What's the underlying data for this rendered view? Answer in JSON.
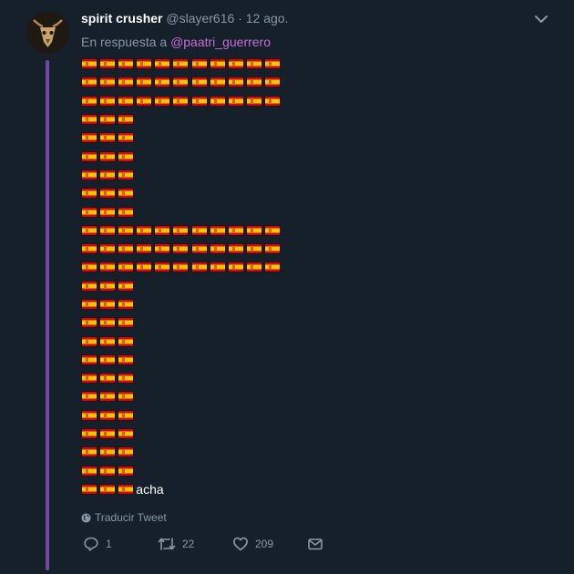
{
  "tweet": {
    "display_name": "spirit crusher",
    "handle": "@slayer616",
    "separator": "·",
    "date": "12 ago.",
    "reply_prefix": "En respuesta a",
    "reply_mention": "@paatri_guerrero",
    "flag_rows": [
      11,
      11,
      11,
      3,
      3,
      3,
      3,
      3,
      3,
      11,
      11,
      11,
      3,
      3,
      3,
      3,
      3,
      3,
      3,
      3,
      3,
      3,
      3,
      3
    ],
    "tail_text": "acha",
    "translate_label": "Traducir Tweet",
    "counts": {
      "replies": "1",
      "retweets": "22",
      "likes": "209"
    }
  },
  "icons": {
    "caret": "chevron-down-icon",
    "globe": "globe-icon",
    "reply": "reply-icon",
    "retweet": "retweet-icon",
    "like": "heart-icon",
    "share": "envelope-icon",
    "flag": "spain-flag-emoji"
  },
  "colors": {
    "background": "#15202b",
    "muted": "#8899a6",
    "mention": "#c76cd8",
    "thread_line": "#6f4aa3"
  }
}
